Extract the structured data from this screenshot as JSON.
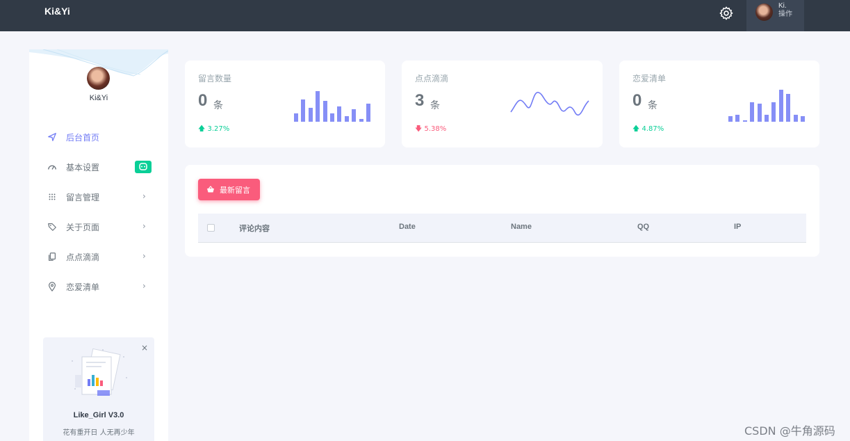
{
  "header": {
    "brand": "Ki&Yi",
    "settings_icon": "gear-icon",
    "user_name": "Ki.",
    "user_role": "操作"
  },
  "sidebar": {
    "profile_name": "Ki&Yi",
    "items": [
      {
        "label": "后台首页",
        "icon": "navigation-icon",
        "active": true
      },
      {
        "label": "基本设置",
        "icon": "speedometer-icon",
        "badge": true
      },
      {
        "label": "留言管理",
        "icon": "grid-dots-icon",
        "chevron": true
      },
      {
        "label": "关于页面",
        "icon": "tags-icon",
        "chevron": true
      },
      {
        "label": "点点滴滴",
        "icon": "copy-icon",
        "chevron": true
      },
      {
        "label": "恋爱清单",
        "icon": "map-pin-icon",
        "chevron": true
      }
    ],
    "promo": {
      "title": "Like_Girl V3.0",
      "subtitle": "花有重开日 人无再少年"
    }
  },
  "stats": [
    {
      "label": "留言数量",
      "value": "0",
      "unit": "条",
      "trend": "3.27%",
      "direction": "up"
    },
    {
      "label": "点点滴滴",
      "value": "3",
      "unit": "条",
      "trend": "5.38%",
      "direction": "down"
    },
    {
      "label": "恋爱清单",
      "value": "0",
      "unit": "条",
      "trend": "4.87%",
      "direction": "up"
    }
  ],
  "table": {
    "new_button": "最新留言",
    "columns": [
      "评论内容",
      "Date",
      "Name",
      "QQ",
      "IP"
    ]
  },
  "watermark": "CSDN @牛角源码",
  "colors": {
    "topbar": "#313a46",
    "accent": "#727cf5",
    "success": "#0acf97",
    "danger": "#fa5c7c"
  }
}
